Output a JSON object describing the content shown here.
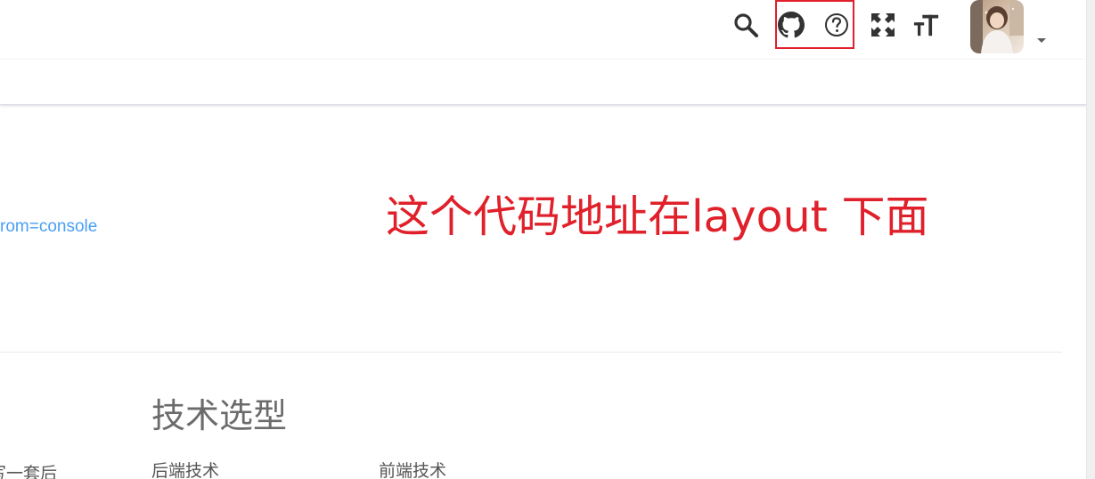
{
  "navbar": {
    "icons": [
      "search-icon",
      "github-icon",
      "question-icon",
      "fullscreen-icon",
      "text-size-icon"
    ],
    "annotation_box_color": "#e0202a"
  },
  "main": {
    "link_fragment": "rom=console",
    "annotation": "这个代码地址在layout 下面",
    "section_title": "技术选型",
    "left_cut_text": "写一套后",
    "columns": [
      "后端技术",
      "前端技术"
    ]
  },
  "colors": {
    "link": "#4a9ff5",
    "annotation": "#e0202a",
    "title": "#6b6b6b"
  }
}
